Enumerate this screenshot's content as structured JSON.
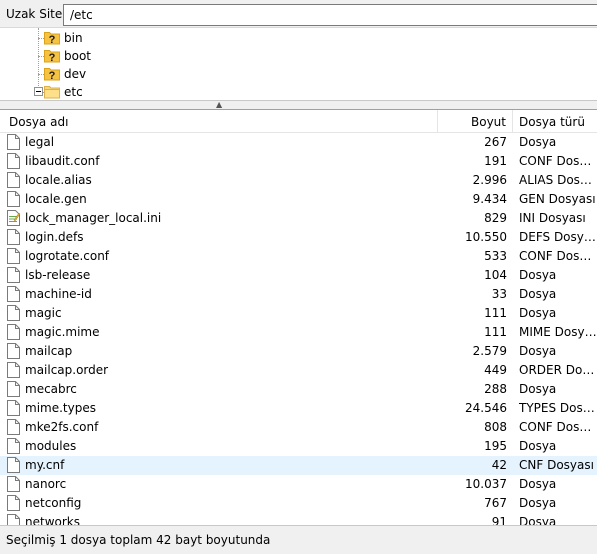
{
  "remote_site": {
    "label": "Uzak Site:",
    "path": "/etc"
  },
  "tree": {
    "items": [
      {
        "name": "bin",
        "icon": "unknown-folder-icon"
      },
      {
        "name": "boot",
        "icon": "unknown-folder-icon"
      },
      {
        "name": "dev",
        "icon": "unknown-folder-icon"
      },
      {
        "name": "etc",
        "icon": "folder-icon",
        "expanded": true
      }
    ]
  },
  "file_list": {
    "columns": {
      "name": "Dosya adı",
      "size": "Boyut",
      "type": "Dosya türü"
    },
    "rows": [
      {
        "name": "legal",
        "size": "267",
        "type": "Dosya",
        "icon": "file-icon"
      },
      {
        "name": "libaudit.conf",
        "size": "191",
        "type": "CONF Dosyası",
        "icon": "file-icon"
      },
      {
        "name": "locale.alias",
        "size": "2.996",
        "type": "ALIAS Dosyası",
        "icon": "file-icon"
      },
      {
        "name": "locale.gen",
        "size": "9.434",
        "type": "GEN Dosyası",
        "icon": "file-icon"
      },
      {
        "name": "lock_manager_local.ini",
        "size": "829",
        "type": "INI Dosyası",
        "icon": "ini-file-icon"
      },
      {
        "name": "login.defs",
        "size": "10.550",
        "type": "DEFS Dosyası",
        "icon": "file-icon"
      },
      {
        "name": "logrotate.conf",
        "size": "533",
        "type": "CONF Dosyası",
        "icon": "file-icon"
      },
      {
        "name": "lsb-release",
        "size": "104",
        "type": "Dosya",
        "icon": "file-icon"
      },
      {
        "name": "machine-id",
        "size": "33",
        "type": "Dosya",
        "icon": "file-icon"
      },
      {
        "name": "magic",
        "size": "111",
        "type": "Dosya",
        "icon": "file-icon"
      },
      {
        "name": "magic.mime",
        "size": "111",
        "type": "MIME Dosyası",
        "icon": "file-icon"
      },
      {
        "name": "mailcap",
        "size": "2.579",
        "type": "Dosya",
        "icon": "file-icon"
      },
      {
        "name": "mailcap.order",
        "size": "449",
        "type": "ORDER Dosyası",
        "icon": "file-icon"
      },
      {
        "name": "mecabrc",
        "size": "288",
        "type": "Dosya",
        "icon": "file-icon"
      },
      {
        "name": "mime.types",
        "size": "24.546",
        "type": "TYPES Dosyası",
        "icon": "file-icon"
      },
      {
        "name": "mke2fs.conf",
        "size": "808",
        "type": "CONF Dosyası",
        "icon": "file-icon"
      },
      {
        "name": "modules",
        "size": "195",
        "type": "Dosya",
        "icon": "file-icon"
      },
      {
        "name": "my.cnf",
        "size": "42",
        "type": "CNF Dosyası",
        "icon": "file-icon",
        "selected": true
      },
      {
        "name": "nanorc",
        "size": "10.037",
        "type": "Dosya",
        "icon": "file-icon"
      },
      {
        "name": "netconfig",
        "size": "767",
        "type": "Dosya",
        "icon": "file-icon"
      },
      {
        "name": "networks",
        "size": "91",
        "type": "Dosya",
        "icon": "file-icon"
      }
    ]
  },
  "status_bar": {
    "text": "Seçilmiş 1 dosya toplam 42 bayt boyutunda"
  }
}
